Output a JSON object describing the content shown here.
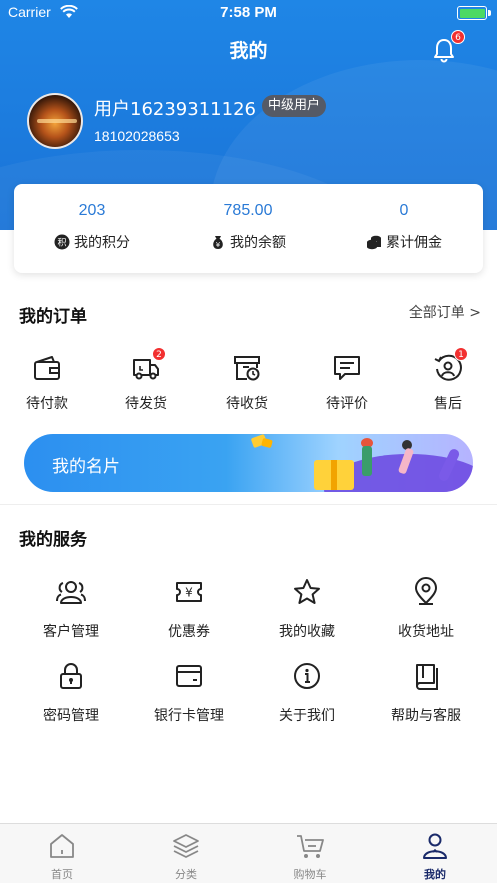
{
  "status_bar": {
    "carrier": "Carrier",
    "time": "7:58 PM"
  },
  "header": {
    "title": "我的",
    "notification_count": "6"
  },
  "user": {
    "name": "用户16239311126",
    "level": "中级用户",
    "phone": "18102028653"
  },
  "stats": [
    {
      "value": "203",
      "label": "我的积分",
      "icon": "points-icon"
    },
    {
      "value": "785.00",
      "label": "我的余额",
      "icon": "money-bag-icon"
    },
    {
      "value": "0",
      "label": "累计佣金",
      "icon": "coins-icon"
    }
  ],
  "orders": {
    "title": "我的订单",
    "all_link": "全部订单 >",
    "items": [
      {
        "label": "待付款",
        "icon": "wallet-icon",
        "badge": ""
      },
      {
        "label": "待发货",
        "icon": "truck-icon",
        "badge": "2"
      },
      {
        "label": "待收货",
        "icon": "package-clock-icon",
        "badge": ""
      },
      {
        "label": "待评价",
        "icon": "comment-icon",
        "badge": ""
      },
      {
        "label": "售后",
        "icon": "after-sales-icon",
        "badge": "1"
      }
    ]
  },
  "banner": {
    "label": "我的名片"
  },
  "services": {
    "title": "我的服务",
    "items": [
      {
        "label": "客户管理",
        "icon": "customers-icon"
      },
      {
        "label": "优惠券",
        "icon": "coupon-icon"
      },
      {
        "label": "我的收藏",
        "icon": "star-icon"
      },
      {
        "label": "收货地址",
        "icon": "location-pin-icon"
      },
      {
        "label": "密码管理",
        "icon": "lock-icon"
      },
      {
        "label": "银行卡管理",
        "icon": "bank-card-icon"
      },
      {
        "label": "关于我们",
        "icon": "info-icon"
      },
      {
        "label": "帮助与客服",
        "icon": "help-book-icon"
      }
    ]
  },
  "tabbar": [
    {
      "label": "首页",
      "icon": "home-icon",
      "active": false
    },
    {
      "label": "分类",
      "icon": "layers-icon",
      "active": false
    },
    {
      "label": "购物车",
      "icon": "cart-icon",
      "active": false
    },
    {
      "label": "我的",
      "icon": "user-icon",
      "active": true
    }
  ],
  "colors": {
    "header_blue": "#1a73d7",
    "accent_blue": "#2a7ad6",
    "badge_red": "#f23030",
    "active_tab": "#1a2a6a"
  }
}
